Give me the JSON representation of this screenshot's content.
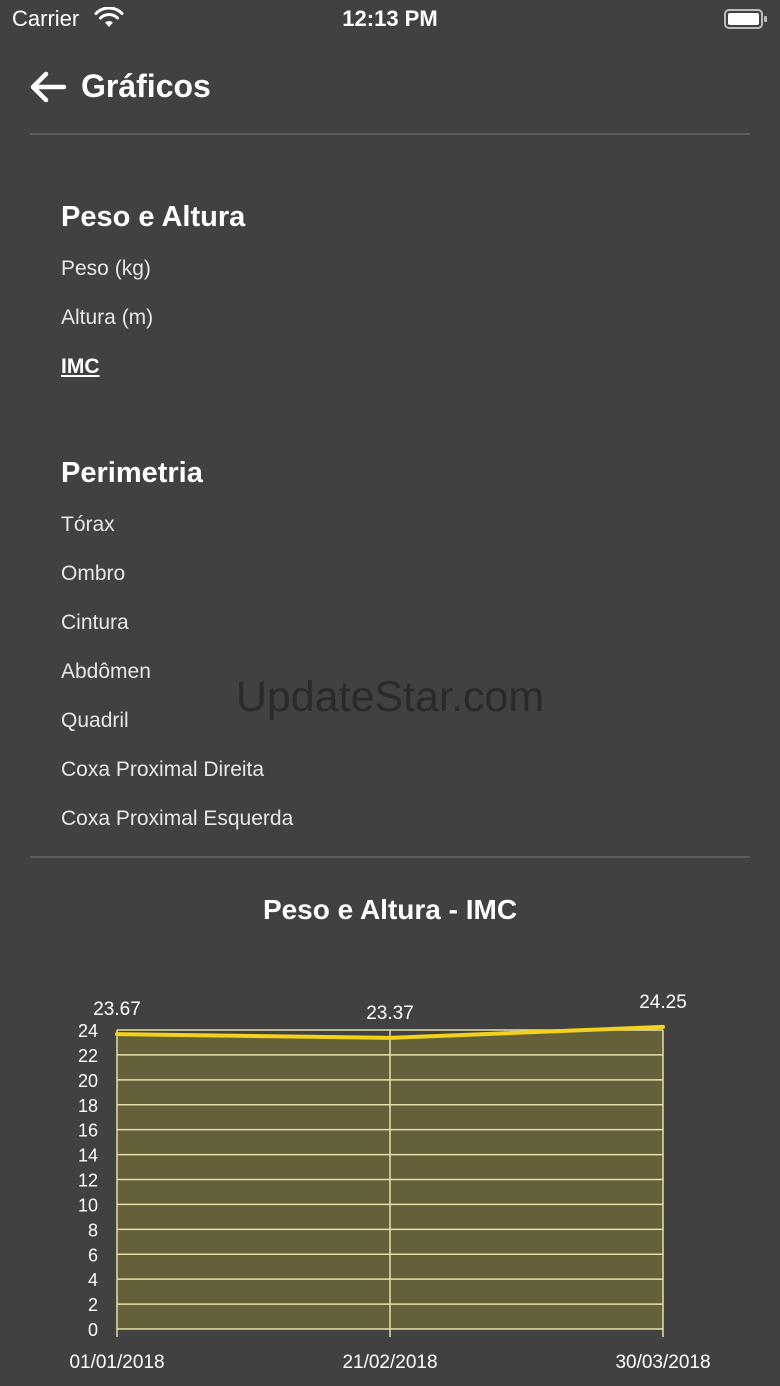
{
  "status_bar": {
    "carrier": "Carrier",
    "time": "12:13 PM"
  },
  "header": {
    "title": "Gráficos",
    "back_icon": "arrow-left-icon"
  },
  "sections": [
    {
      "title": "Peso e Altura",
      "items": [
        "Peso (kg)",
        "Altura (m)",
        "IMC"
      ],
      "selected": "IMC"
    },
    {
      "title": "Perimetria",
      "items": [
        "Tórax",
        "Ombro",
        "Cintura",
        "Abdômen",
        "Quadril",
        "Coxa Proximal Direita",
        "Coxa Proximal Esquerda"
      ]
    }
  ],
  "watermark": "UpdateStar.com",
  "chart_data": {
    "type": "area",
    "title": "Peso e Altura - IMC",
    "x": [
      "01/01/2018",
      "21/02/2018",
      "30/03/2018"
    ],
    "values": [
      23.67,
      23.37,
      24.25
    ],
    "data_labels": [
      "23.67",
      "23.37",
      "24.25"
    ],
    "yticks": [
      0,
      2,
      4,
      6,
      8,
      10,
      12,
      14,
      16,
      18,
      20,
      22,
      24
    ],
    "ylim": [
      0,
      24
    ],
    "grid": true,
    "colors": {
      "line": "#f2d21c",
      "fill": "#646039",
      "grid": "#e6e0a8",
      "axis_text": "#ffffff"
    }
  }
}
